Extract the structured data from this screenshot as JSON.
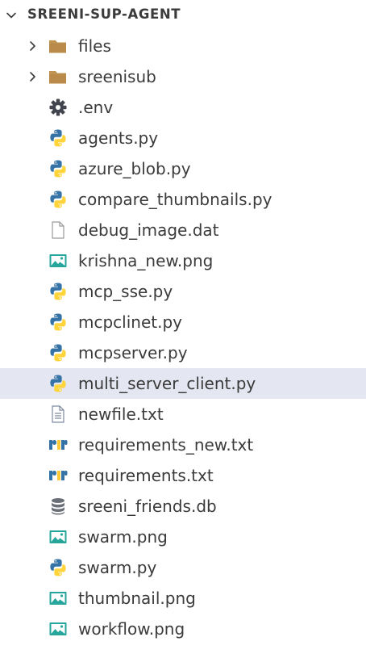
{
  "explorer": {
    "section_title": "SREENI-SUP-AGENT",
    "items": [
      {
        "label": "files",
        "icon": "folder-icon",
        "kind": "folder"
      },
      {
        "label": "sreenisub",
        "icon": "folder-icon",
        "kind": "folder"
      },
      {
        "label": ".env",
        "icon": "gear-icon",
        "kind": "file"
      },
      {
        "label": "agents.py",
        "icon": "python-icon",
        "kind": "file"
      },
      {
        "label": "azure_blob.py",
        "icon": "python-icon",
        "kind": "file"
      },
      {
        "label": "compare_thumbnails.py",
        "icon": "python-icon",
        "kind": "file"
      },
      {
        "label": "debug_image.dat",
        "icon": "blank-file-icon",
        "kind": "file"
      },
      {
        "label": "krishna_new.png",
        "icon": "image-icon",
        "kind": "file"
      },
      {
        "label": "mcp_sse.py",
        "icon": "python-icon",
        "kind": "file"
      },
      {
        "label": "mcpclinet.py",
        "icon": "python-icon",
        "kind": "file"
      },
      {
        "label": "mcpserver.py",
        "icon": "python-icon",
        "kind": "file"
      },
      {
        "label": "multi_server_client.py",
        "icon": "python-icon",
        "kind": "file",
        "selected": true
      },
      {
        "label": "newfile.txt",
        "icon": "text-file-icon",
        "kind": "file"
      },
      {
        "label": "requirements_new.txt",
        "icon": "pip-requirements-icon",
        "kind": "file"
      },
      {
        "label": "requirements.txt",
        "icon": "pip-requirements-icon",
        "kind": "file"
      },
      {
        "label": "sreeni_friends.db",
        "icon": "database-icon",
        "kind": "file"
      },
      {
        "label": "swarm.png",
        "icon": "image-icon",
        "kind": "file"
      },
      {
        "label": "swarm.py",
        "icon": "python-icon",
        "kind": "file"
      },
      {
        "label": "thumbnail.png",
        "icon": "image-icon",
        "kind": "file"
      },
      {
        "label": "workflow.png",
        "icon": "image-icon",
        "kind": "file"
      }
    ],
    "colors": {
      "selected_row": "#e4e6f1",
      "folder": "#c09553",
      "python_blue": "#3572a5",
      "python_yellow": "#ffd43b",
      "image_green": "#26a69a",
      "text": "#3b3b3b"
    }
  }
}
